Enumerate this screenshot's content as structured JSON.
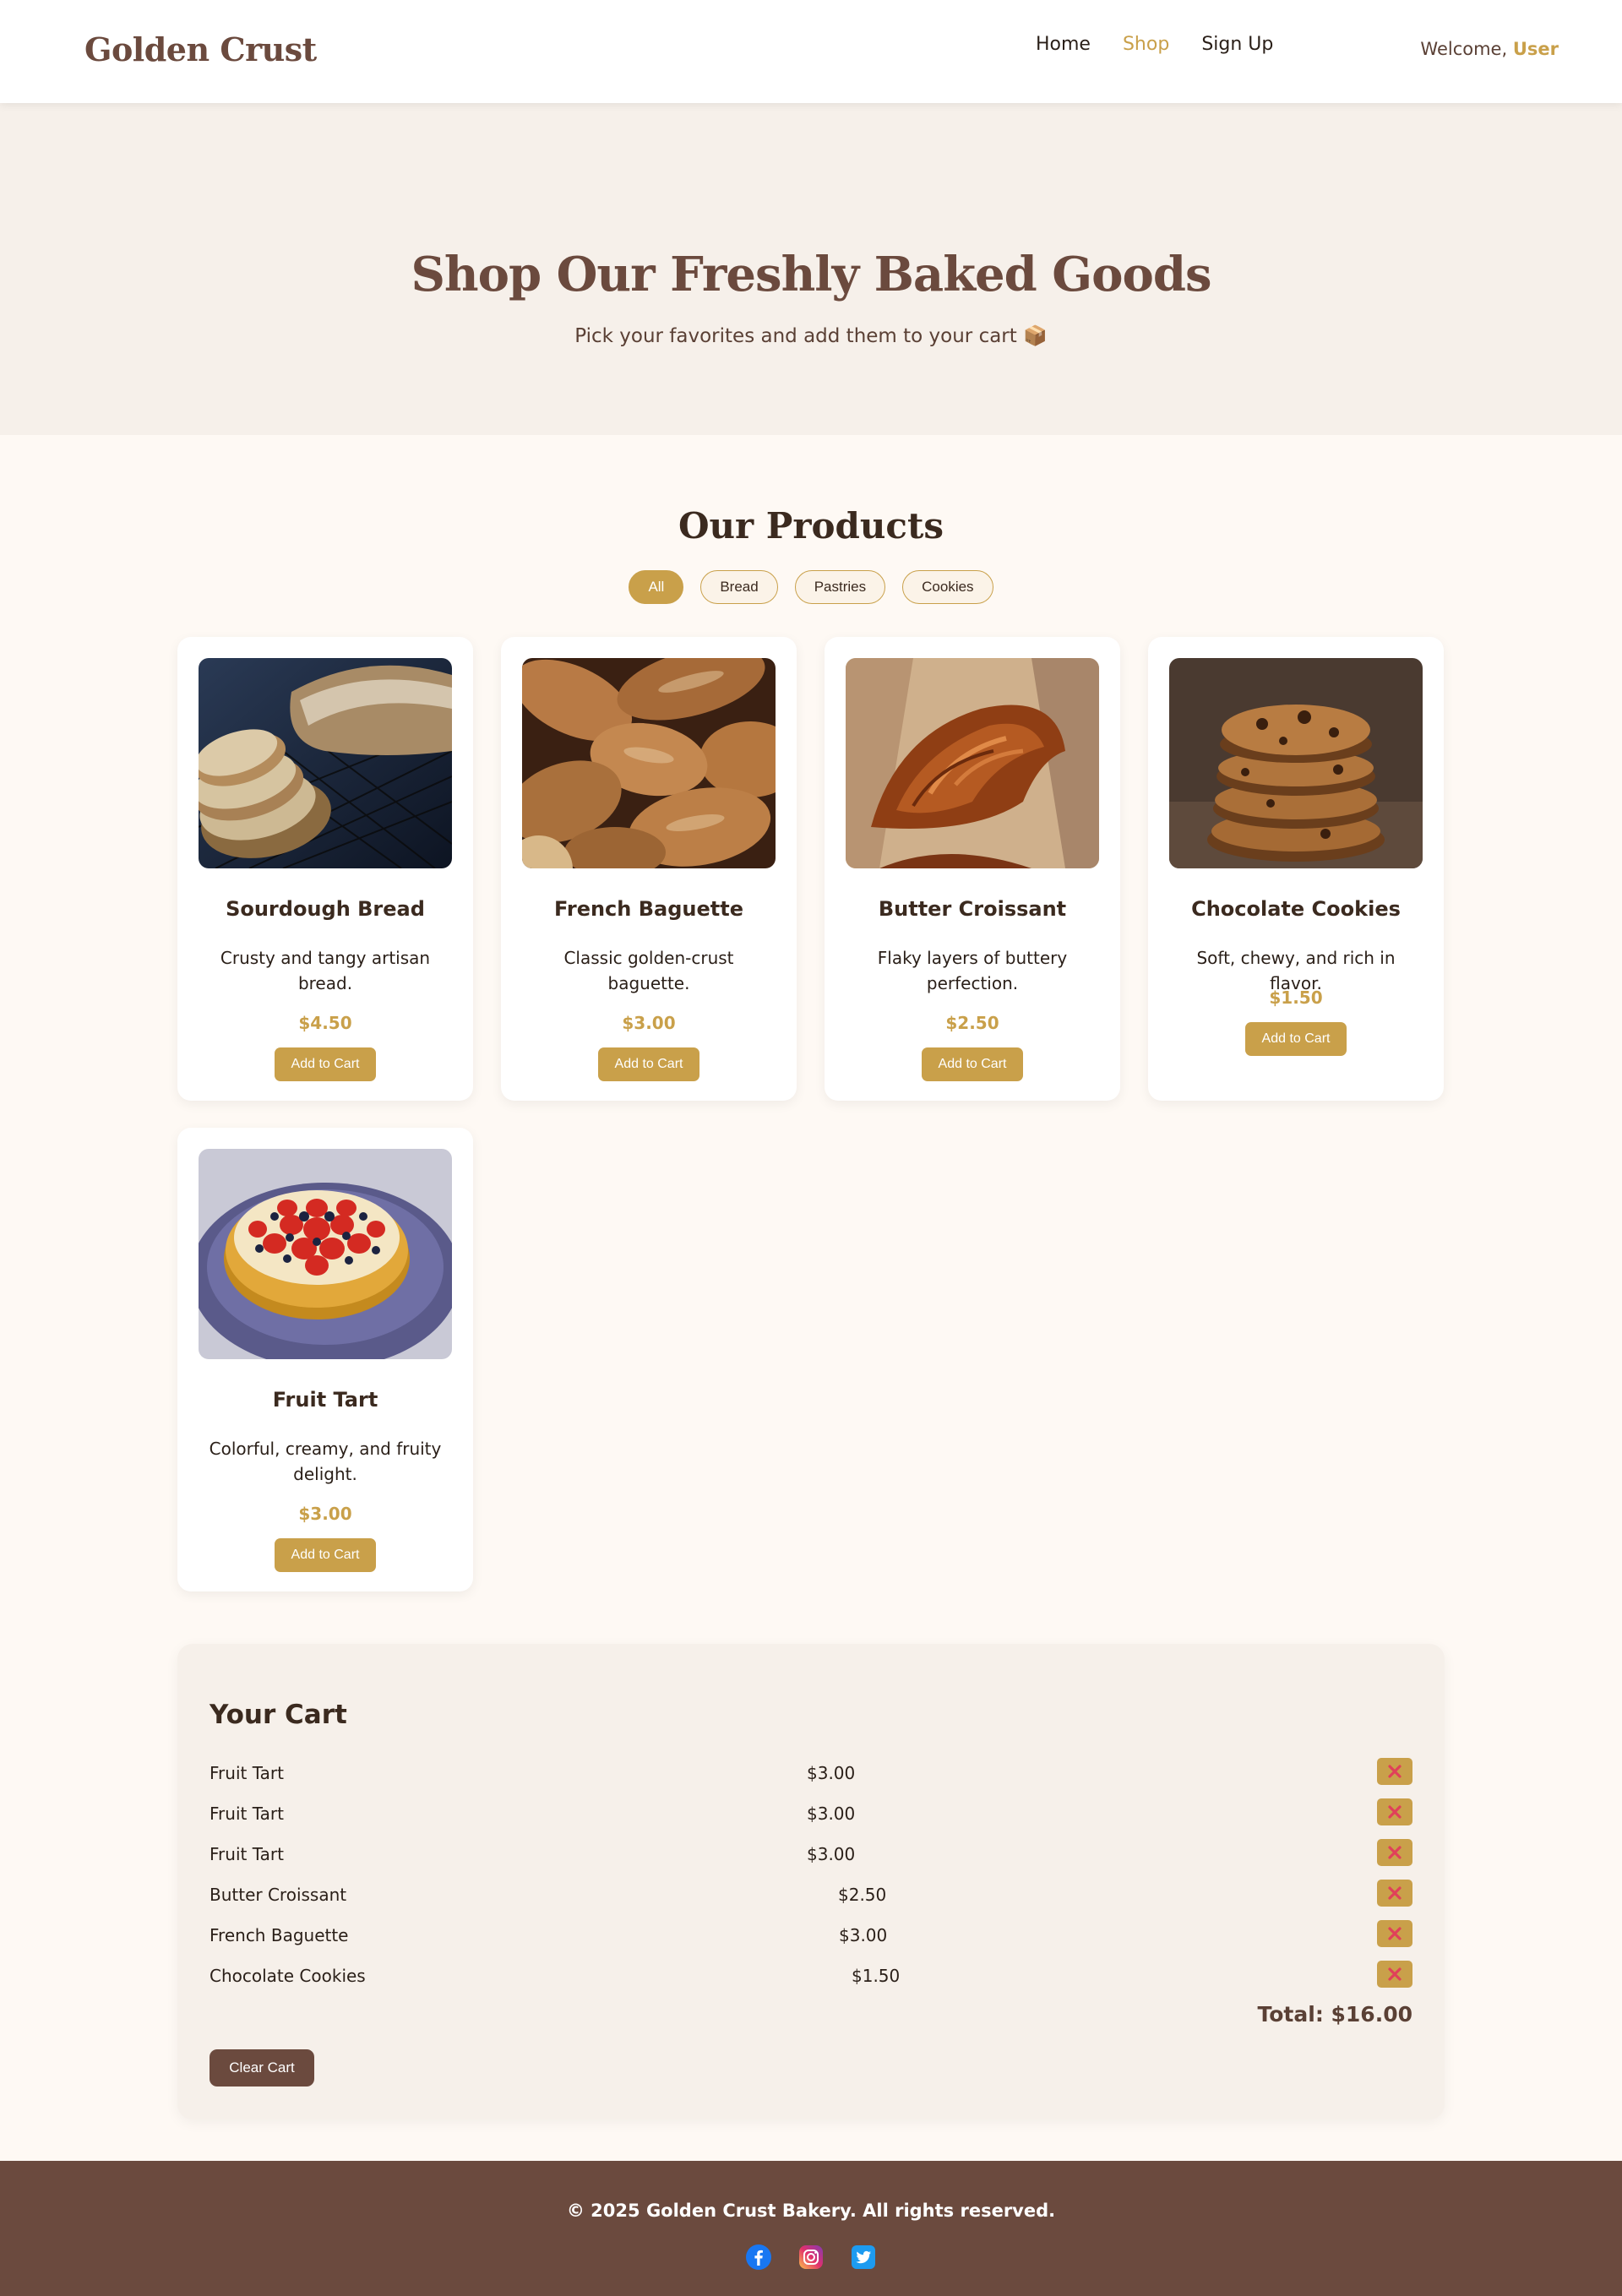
{
  "header": {
    "logo": "Golden Crust",
    "nav": [
      "Home",
      "Shop",
      "Sign Up"
    ],
    "welcome_prefix": "Welcome,",
    "user": "User"
  },
  "hero": {
    "title": "Shop Our Freshly Baked Goods",
    "subtitle": "Pick your favorites and add them to your cart 📦"
  },
  "products": {
    "title": "Our Products",
    "filters": [
      "All",
      "Bread",
      "Pastries",
      "Cookies"
    ],
    "active_filter": "All",
    "add_label": "Add to Cart",
    "items": [
      {
        "name": "Sourdough Bread",
        "desc": "Crusty and tangy artisan bread.",
        "price": "$4.50",
        "image": "sourdough-bread-image"
      },
      {
        "name": "French Baguette",
        "desc": "Classic golden-crust baguette.",
        "price": "$3.00",
        "image": "french-baguette-image"
      },
      {
        "name": "Butter Croissant",
        "desc": "Flaky layers of buttery perfection.",
        "price": "$2.50",
        "image": "butter-croissant-image"
      },
      {
        "name": "Chocolate Cookies",
        "desc": "Soft, chewy, and rich in flavor.",
        "price": "$1.50",
        "image": "chocolate-cookies-image"
      },
      {
        "name": "Fruit Tart",
        "desc": "Colorful, creamy, and fruity delight.",
        "price": "$3.00",
        "image": "fruit-tart-image"
      }
    ]
  },
  "cart": {
    "title": "Your Cart",
    "items": [
      {
        "name": "Fruit Tart",
        "price": "$3.00"
      },
      {
        "name": "Fruit Tart",
        "price": "$3.00"
      },
      {
        "name": "Fruit Tart",
        "price": "$3.00"
      },
      {
        "name": "Butter Croissant",
        "price": "$2.50"
      },
      {
        "name": "French Baguette",
        "price": "$3.00"
      },
      {
        "name": "Chocolate Cookies",
        "price": "$1.50"
      }
    ],
    "remove_icon": "close-icon",
    "total": "Total: $16.00",
    "clear_label": "Clear Cart"
  },
  "footer": {
    "copyright": "© 2025 Golden Crust Bakery. All rights reserved.",
    "socials": [
      "facebook-icon",
      "instagram-icon",
      "twitter-icon"
    ]
  },
  "colors": {
    "accent": "#c9a04a",
    "brown": "#6b4a3e",
    "background": "#fef9f4"
  }
}
